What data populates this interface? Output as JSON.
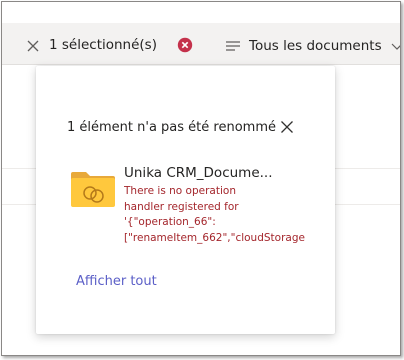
{
  "command_bar": {
    "selection_label": "1 sélectionné(s)",
    "view_label": "Tous les documents"
  },
  "callout": {
    "title": "1 élément n'a pas été renommé",
    "item_name": "Unika CRM_Docume...",
    "error_lines": [
      "There is no operation",
      "handler registered for",
      "'{\"operation_66\":",
      "[\"renameItem_662\",\"cloudStorage"
    ],
    "show_all_label": "Afficher tout"
  },
  "colors": {
    "error_text": "#a4262c",
    "link": "#5b5fc7",
    "clear_badge": "#c4314b",
    "folder": "#ffc83d"
  },
  "icons": [
    "close-icon",
    "clear-selection-icon",
    "view-list-icon",
    "chevron-down-icon",
    "dismiss-icon",
    "shared-folder-icon"
  ]
}
